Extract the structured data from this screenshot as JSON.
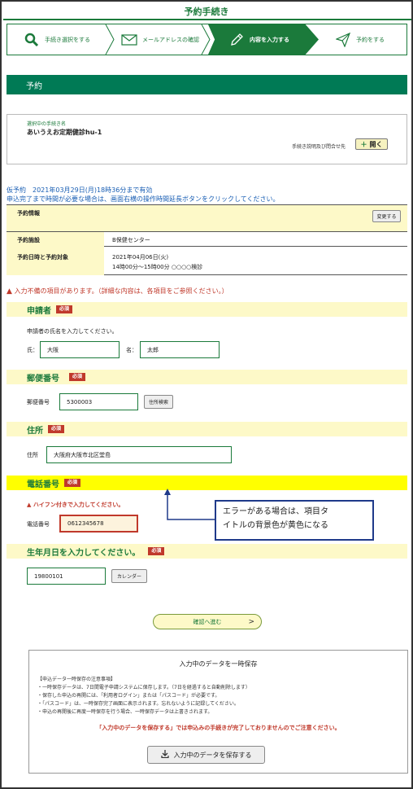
{
  "page_title": "予約手続き",
  "steps": [
    {
      "label": "手続き選択をする",
      "icon": "search-icon"
    },
    {
      "label": "メールアドレスの確認",
      "icon": "mail-icon"
    },
    {
      "label": "内容を入力する",
      "icon": "pencil-icon",
      "active": true
    },
    {
      "label": "予約をする",
      "icon": "paper-plane-icon"
    }
  ],
  "section_title": "予約",
  "selected": {
    "label": "選択中の手続き名",
    "name": "あいうえお定期健診hu-1",
    "help_text": "手続き説明及び問合せ先",
    "open_button": "開く",
    "open_plus": "＋"
  },
  "notice": {
    "line1": "仮予約　2021年03月29日(月)18時36分まで有効",
    "line2": "申込完了まで時間が必要な場合は、画面右横の操作時間延長ボタンをクリックしてください。"
  },
  "reservation": {
    "title": "予約情報",
    "change_button": "変更する",
    "facility_label": "予約施設",
    "facility_value": "B保健センター",
    "datetime_label": "予約日時と予約対象",
    "date_value": "2021年04月06日(火)",
    "time_value": "14時00分～15時00分 ○○○○検診"
  },
  "error_message": "入力不備の項目があります。（詳細な内容は、各項目をご参照ください。）",
  "required_badge": "必須",
  "applicant": {
    "title": "申請者",
    "instruction": "申請者の氏名を入力してください。",
    "last_label": "氏：",
    "last_value": "大阪",
    "first_label": "名：",
    "first_value": "太郎"
  },
  "postal": {
    "title": "郵便番号",
    "label": "郵便番号",
    "value": "5300003",
    "search_button": "住所検索"
  },
  "address": {
    "title": "住所",
    "label": "住所",
    "value": "大阪府大阪市北区堂島"
  },
  "phone": {
    "title": "電話番号",
    "error": "ハイフン付きで入力してください。",
    "label": "電話番号",
    "value": "0612345678"
  },
  "annotation": {
    "line1": "エラーがある場合は、項目タ",
    "line2": "イトルの背景色が黄色になる"
  },
  "birth": {
    "title": "生年月日を入力してください。",
    "value": "19800101",
    "calendar_button": "カレンダー"
  },
  "confirm_button": "確認へ進む",
  "confirm_arrow": ">",
  "save": {
    "title": "入力中のデータを一時保存",
    "notes": [
      "【申込データ一時保存の注意事項】",
      "・一時保存データは、7日間電子申請システムに保存します。（7日を経過すると自動削除します）",
      "・保存した申込の再開には、「利用者ログイン」または「パスコード」が必要です。",
      "・「パスコード」は、一時保存完了画面に表示されます。忘れないように記録してください。",
      "・申込の再開後に再度一時保存を行う場合、一時保存データは上書きされます。"
    ],
    "warning": "「入力中のデータを保存する」では申込みの手続きが完了しておりませんのでご注意ください。",
    "button": "入力中のデータを保存する"
  },
  "colors": {
    "brand_green": "#1b7a3b",
    "header_green": "#007a55",
    "error_red": "#c0392b",
    "highlight_yellow": "#ffff00",
    "label_bg": "#fdf9c8"
  }
}
